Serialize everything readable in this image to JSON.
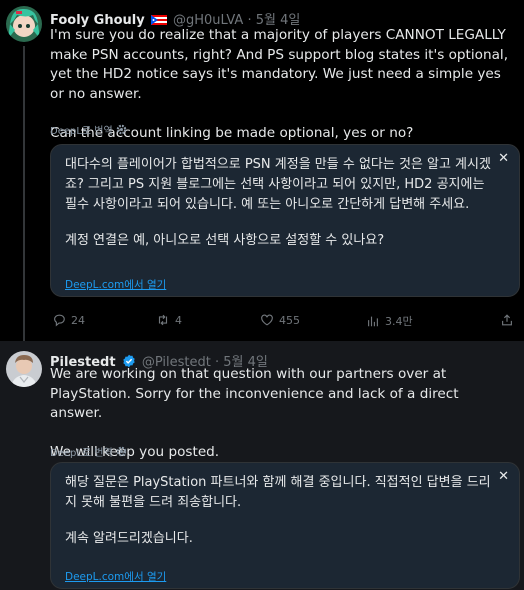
{
  "tweets": [
    {
      "author_name": "Fooly Ghouly",
      "handle": "@gH0uLVA",
      "date": "· 5월 4일",
      "text_p1": "I'm sure you do realize that a majority of players CANNOT LEGALLY make PSN accounts, right? And PS support blog states it's optional, yet the HD2 notice says it's mandatory. We just need a simple yes or no answer.",
      "text_p2": "Can the account linking be made optional, yes or no?",
      "translate_label": "DeepL로 번역",
      "translation_p1": "대다수의 플레이어가 합법적으로 PSN 계정을 만들 수 없다는 것은 알고 계시겠죠? 그리고 PS 지원 블로그에는 선택 사항이라고 되어 있지만, HD2 공지에는 필수 사항이라고 되어 있습니다. 예 또는 아니오로 간단하게 답변해 주세요.",
      "translation_p2": "계정 연결은 예, 아니오로 선택 사항으로 설정할 수 있나요?",
      "open_deepl": "DeepL.com에서 열기",
      "close": "✕",
      "stats": {
        "replies": "24",
        "retweets": "4",
        "likes": "455",
        "views": "3.4만"
      }
    },
    {
      "author_name": "Pilestedt",
      "handle": "@Pilestedt",
      "date": "· 5월 4일",
      "text_p1": "We are working on that question with our partners over at PlayStation. Sorry for the inconvenience and lack of a direct answer.",
      "text_p2": "We will keep you posted.",
      "translate_label": "DeepL로 번역",
      "translation_p1": "해당 질문은 PlayStation 파트너와 함께 해결 중입니다. 직접적인 답변을 드리지 못해 불편을 드려 죄송합니다.",
      "translation_p2": "계속 알려드리겠습니다.",
      "open_deepl": "DeepL.com에서 열기",
      "close": "✕"
    }
  ],
  "colors": {
    "accent": "#1d9bf0",
    "muted": "#71767b",
    "translation_bg": "#1c2733",
    "verified": "#1d9bf0"
  },
  "icons": [
    "puerto-rico-flag-icon",
    "verified-badge-icon",
    "gear-icon",
    "close-icon",
    "reply-icon",
    "retweet-icon",
    "like-icon",
    "views-icon",
    "share-icon"
  ]
}
